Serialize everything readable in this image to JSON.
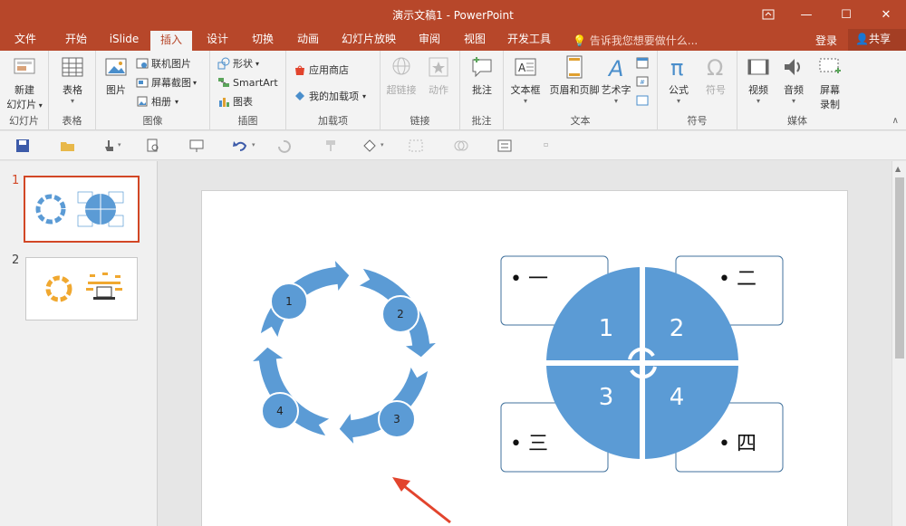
{
  "window": {
    "title": "演示文稿1 - PowerPoint",
    "buttons": {
      "restore_icon": "ribbon-display-icon",
      "minimize": "—",
      "maximize": "☐",
      "close": "✕"
    }
  },
  "tabs": [
    {
      "label": "文件"
    },
    {
      "label": "开始"
    },
    {
      "label": "iSlide"
    },
    {
      "label": "插入",
      "active": true
    },
    {
      "label": "设计"
    },
    {
      "label": "切换"
    },
    {
      "label": "动画"
    },
    {
      "label": "幻灯片放映"
    },
    {
      "label": "审阅"
    },
    {
      "label": "视图"
    },
    {
      "label": "开发工具"
    }
  ],
  "tellme": "告诉我您想要做什么...",
  "login": "登录",
  "share": "共享",
  "ribbon": {
    "slides": {
      "label": "幻灯片",
      "new_slide": "新建",
      "new_slide2": "幻灯片"
    },
    "tables": {
      "label": "表格",
      "table": "表格"
    },
    "images": {
      "label": "图像",
      "picture": "图片",
      "online_picture": "联机图片",
      "screenshot": "屏幕截图",
      "album": "相册"
    },
    "illustrations": {
      "label": "插图",
      "shapes": "形状",
      "smartart": "SmartArt",
      "chart": "图表"
    },
    "addins": {
      "label": "加载项",
      "store": "应用商店",
      "my_addins": "我的加载项"
    },
    "links": {
      "label": "链接",
      "hyperlink": "超链接",
      "action": "动作"
    },
    "comments": {
      "label": "批注",
      "comment": "批注"
    },
    "text": {
      "label": "文本",
      "textbox": "文本框",
      "header_footer": "页眉和页脚",
      "wordart": "艺术字"
    },
    "symbols": {
      "label": "符号",
      "equation": "公式",
      "symbol": "符号"
    },
    "media": {
      "label": "媒体",
      "video": "视频",
      "audio": "音频",
      "screen_rec": "屏幕",
      "screen_rec2": "录制"
    }
  },
  "thumbnails": [
    {
      "number": "1",
      "selected": true
    },
    {
      "number": "2",
      "selected": false
    }
  ],
  "slide": {
    "cycle_labels": [
      "1",
      "2",
      "3",
      "4"
    ],
    "pie_labels": [
      "1",
      "2",
      "3",
      "4"
    ],
    "boxes": [
      "• 一",
      "• 二",
      "• 三",
      "• 四"
    ]
  },
  "colors": {
    "accent": "#b7472a",
    "shape_fill": "#5b9bd5",
    "shape_stroke": "#41719c",
    "arrow": "#e2442d"
  }
}
